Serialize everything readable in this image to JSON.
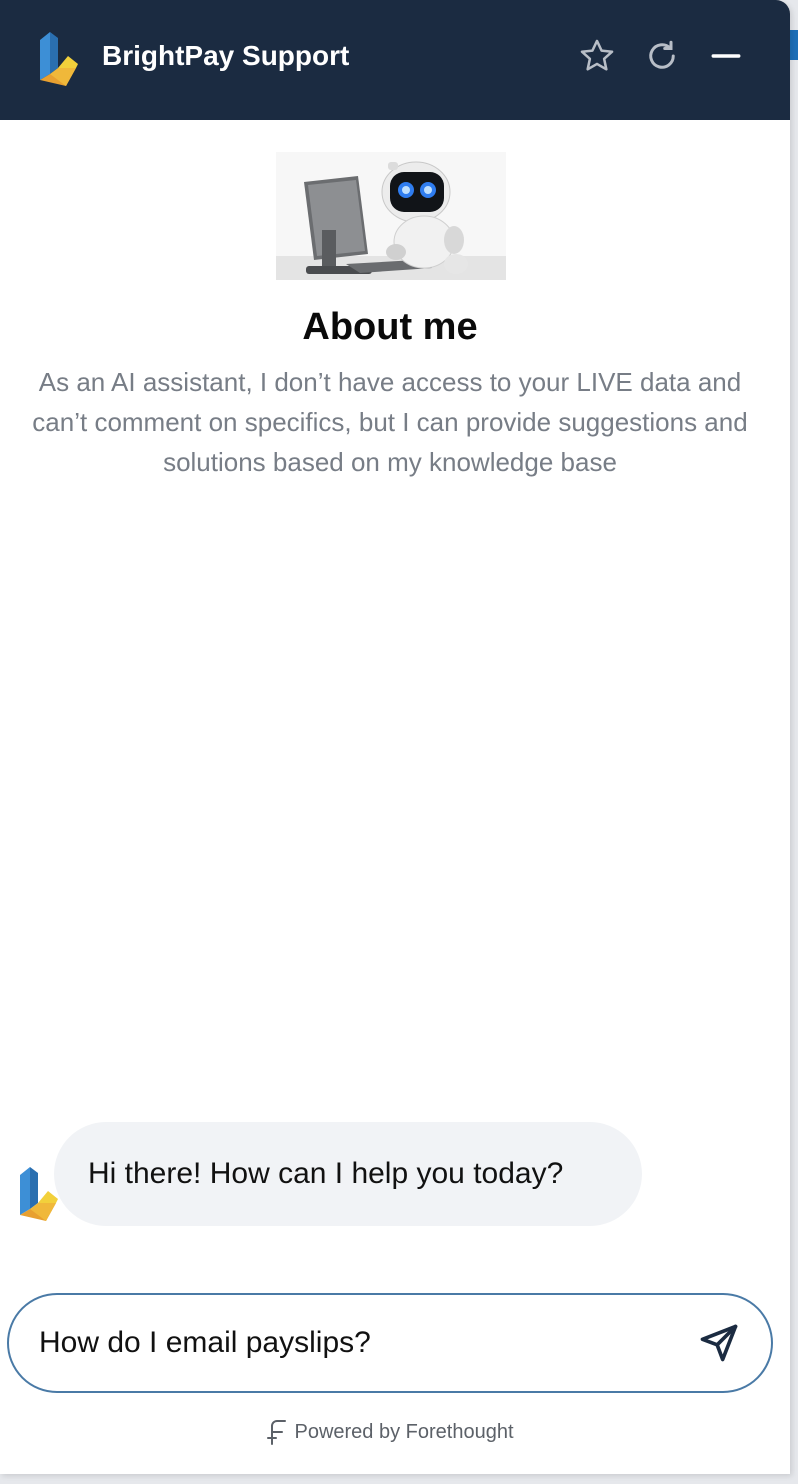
{
  "header": {
    "title": "BrightPay Support",
    "icons": [
      "brightpay-logo",
      "star-icon",
      "refresh-icon",
      "minimize-icon"
    ]
  },
  "about": {
    "image": "robot-at-computer",
    "title": "About me",
    "description": "As an AI assistant, I don’t have access to your LIVE data and can’t comment on specifics, but I can provide suggestions and solutions based on my knowledge base"
  },
  "conversation": {
    "messages": [
      {
        "sender": "bot",
        "text": "Hi there! How can I help you today?"
      }
    ]
  },
  "composer": {
    "value": "How do I email payslips?",
    "send_icon": "send-icon"
  },
  "footer": {
    "powered_by": "Powered by Forethought",
    "icon": "forethought-logo"
  },
  "colors": {
    "header_bg": "#1b2b41",
    "bubble_bg": "#f1f3f6",
    "composer_border": "#4a7aa6",
    "logo_blue": "#3d8fd6",
    "logo_yellow": "#f2d03b",
    "logo_orange": "#e8a030"
  }
}
